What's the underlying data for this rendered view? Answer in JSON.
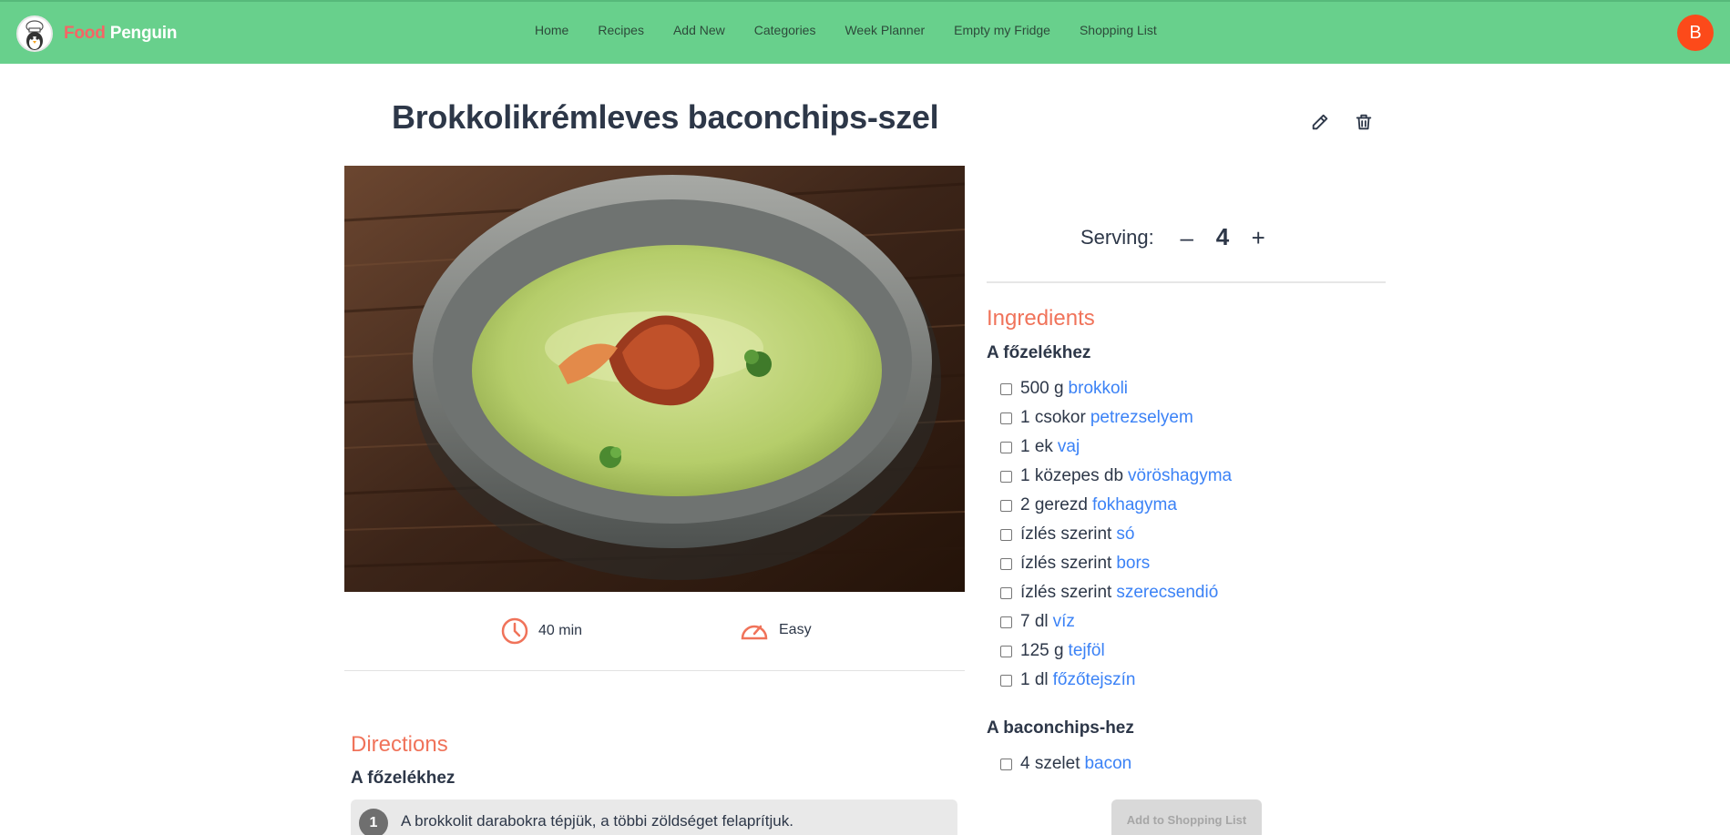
{
  "brand": {
    "food": "Food",
    "penguin": "Penguin"
  },
  "nav": {
    "items": [
      "Home",
      "Recipes",
      "Add New",
      "Categories",
      "Week Planner",
      "Empty my Fridge",
      "Shopping List"
    ]
  },
  "user": {
    "avatar_letter": "B",
    "avatar_color": "#fc4a1a"
  },
  "colors": {
    "navbar": "#68d08c",
    "accent": "#f0735a",
    "link": "#3b82f6"
  },
  "recipe": {
    "title": "Brokkolikrémleves baconchips-szel",
    "time": "40 min",
    "difficulty": "Easy",
    "serving_label": "Serving:",
    "serving_value": "4",
    "decrease_symbol": "–",
    "increase_symbol": "+"
  },
  "ingredients": {
    "heading": "Ingredients",
    "groups": [
      {
        "title": "A főzelékhez",
        "items": [
          {
            "qty": "500 g",
            "name": "brokkoli"
          },
          {
            "qty": "1 csokor",
            "name": "petrezselyem"
          },
          {
            "qty": "1 ek",
            "name": "vaj"
          },
          {
            "qty": "1 közepes db",
            "name": "vöröshagyma"
          },
          {
            "qty": "2 gerezd",
            "name": "fokhagyma"
          },
          {
            "qty": "ízlés szerint",
            "name": "só"
          },
          {
            "qty": "ízlés szerint",
            "name": "bors"
          },
          {
            "qty": "ízlés szerint",
            "name": "szerecsendió"
          },
          {
            "qty": "7 dl",
            "name": "víz"
          },
          {
            "qty": "125 g",
            "name": "tejföl"
          },
          {
            "qty": "1 dl",
            "name": "főzőtejszín"
          }
        ]
      },
      {
        "title": "A baconchips-hez",
        "items": [
          {
            "qty": "4 szelet",
            "name": "bacon"
          }
        ]
      }
    ],
    "add_button": "Add to Shopping List"
  },
  "directions": {
    "heading": "Directions",
    "groups": [
      {
        "title": "A főzelékhez",
        "steps": [
          {
            "num": "1",
            "text": "A brokkolit darabokra tépjük, a többi zöldséget felaprítjuk."
          }
        ]
      }
    ]
  }
}
